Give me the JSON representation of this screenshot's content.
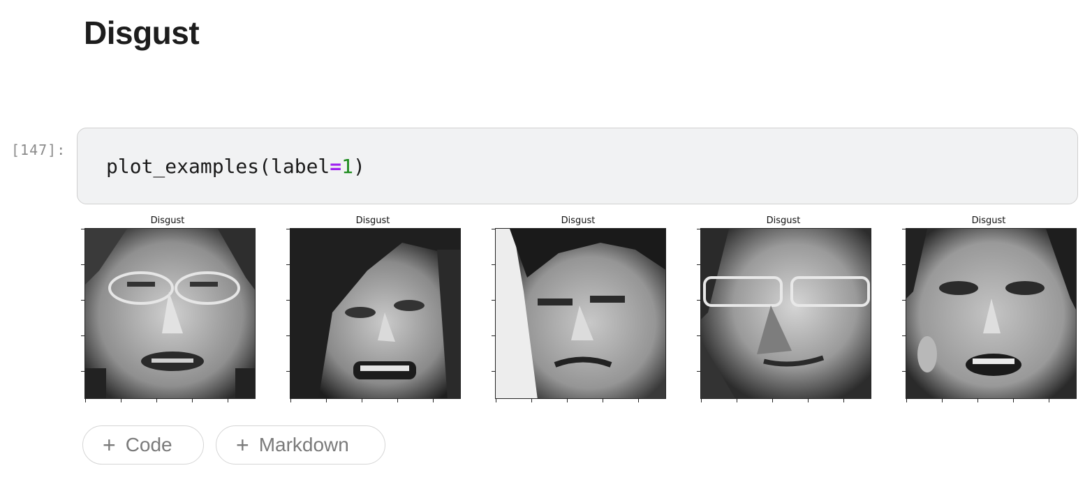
{
  "heading": "Disgust",
  "cell": {
    "prompt": "[147]:",
    "code": {
      "func": "plot_examples(label",
      "op": "=",
      "num": "1",
      "close": ")"
    }
  },
  "output": {
    "panels": [
      {
        "title": "Disgust"
      },
      {
        "title": "Disgust"
      },
      {
        "title": "Disgust"
      },
      {
        "title": "Disgust"
      },
      {
        "title": "Disgust"
      }
    ]
  },
  "buttons": {
    "code": {
      "icon": "plus-icon",
      "label": "Code"
    },
    "markdown": {
      "icon": "plus-icon",
      "label": "Markdown"
    }
  }
}
